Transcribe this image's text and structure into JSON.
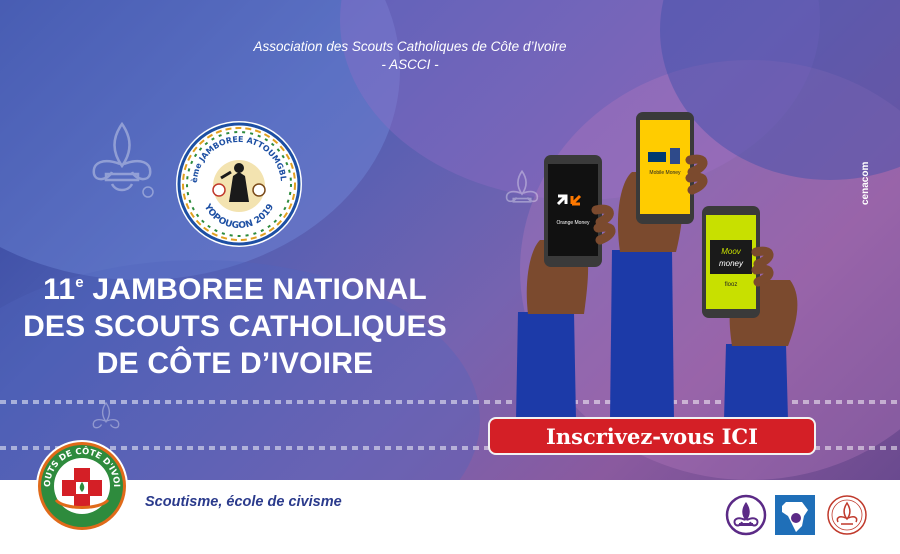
{
  "header": {
    "association_name": "Association des Scouts Catholiques de Côte d’Ivoire",
    "association_acronym": "- ASCCI -"
  },
  "seal": {
    "top_text": "11ème JAMBOREE ATTOUMGBLAN",
    "bottom_text": "YOPOUGON 2019"
  },
  "headline": {
    "ordinal": "11",
    "ordinal_suffix": "e",
    "line1_rest": " JAMBOREE NATIONAL",
    "line2": "DES SCOUTS CATHOLIQUES",
    "line3": "DE CÔTE D’IVOIRE"
  },
  "credit": "cenacom",
  "phones": {
    "left_label": "Orange Money",
    "middle_label": "Mobile Money",
    "right_label_1": "Moov",
    "right_label_2": "money",
    "right_label_3": "flooz"
  },
  "cta": {
    "label": "Inscrivez-vous ICI"
  },
  "badge": {
    "ring_text": "SCOUTS DE CÔTE D'IVOIRE"
  },
  "footer": {
    "slogan": "Scoutisme, école de civisme"
  },
  "colors": {
    "cta_red": "#d41f26",
    "slogan_blue": "#2a3a8c",
    "sleeve_blue": "#1c3aa8",
    "skin": "#7b4a2e"
  }
}
